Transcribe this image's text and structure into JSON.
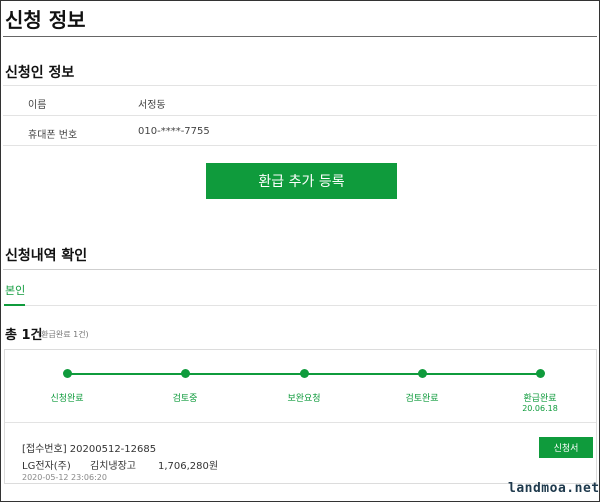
{
  "page": {
    "title": "신청 정보"
  },
  "applicant": {
    "section_title": "신청인 정보",
    "fields": [
      {
        "label": "이름",
        "value": "서정동"
      },
      {
        "label": "휴대폰 번호",
        "value": "010-****-7755"
      }
    ]
  },
  "actions": {
    "add_refund_label": "환급 추가 등록"
  },
  "history": {
    "section_title": "신청내역 확인",
    "tabs": [
      {
        "label": "본인",
        "active": true
      }
    ],
    "total_label": "총 1건",
    "total_sub": "(환급완료 1건)",
    "steps": [
      {
        "label": "신청완료",
        "date": ""
      },
      {
        "label": "검토중",
        "date": ""
      },
      {
        "label": "보완요청",
        "date": ""
      },
      {
        "label": "검토완료",
        "date": ""
      },
      {
        "label": "환급완료",
        "date": "20.06.18"
      }
    ],
    "item": {
      "receipt_no": "[접수번호] 20200512-12685",
      "company": "LG전자(주)",
      "product": "김치냉장고",
      "amount": "1,706,280원",
      "datetime": "2020-05-12 23:06:20",
      "form_button_label": "신청서"
    }
  },
  "watermark": "landmoa.net",
  "colors": {
    "accent": "#0f9b3c",
    "text": "#222222",
    "muted": "#888888"
  }
}
